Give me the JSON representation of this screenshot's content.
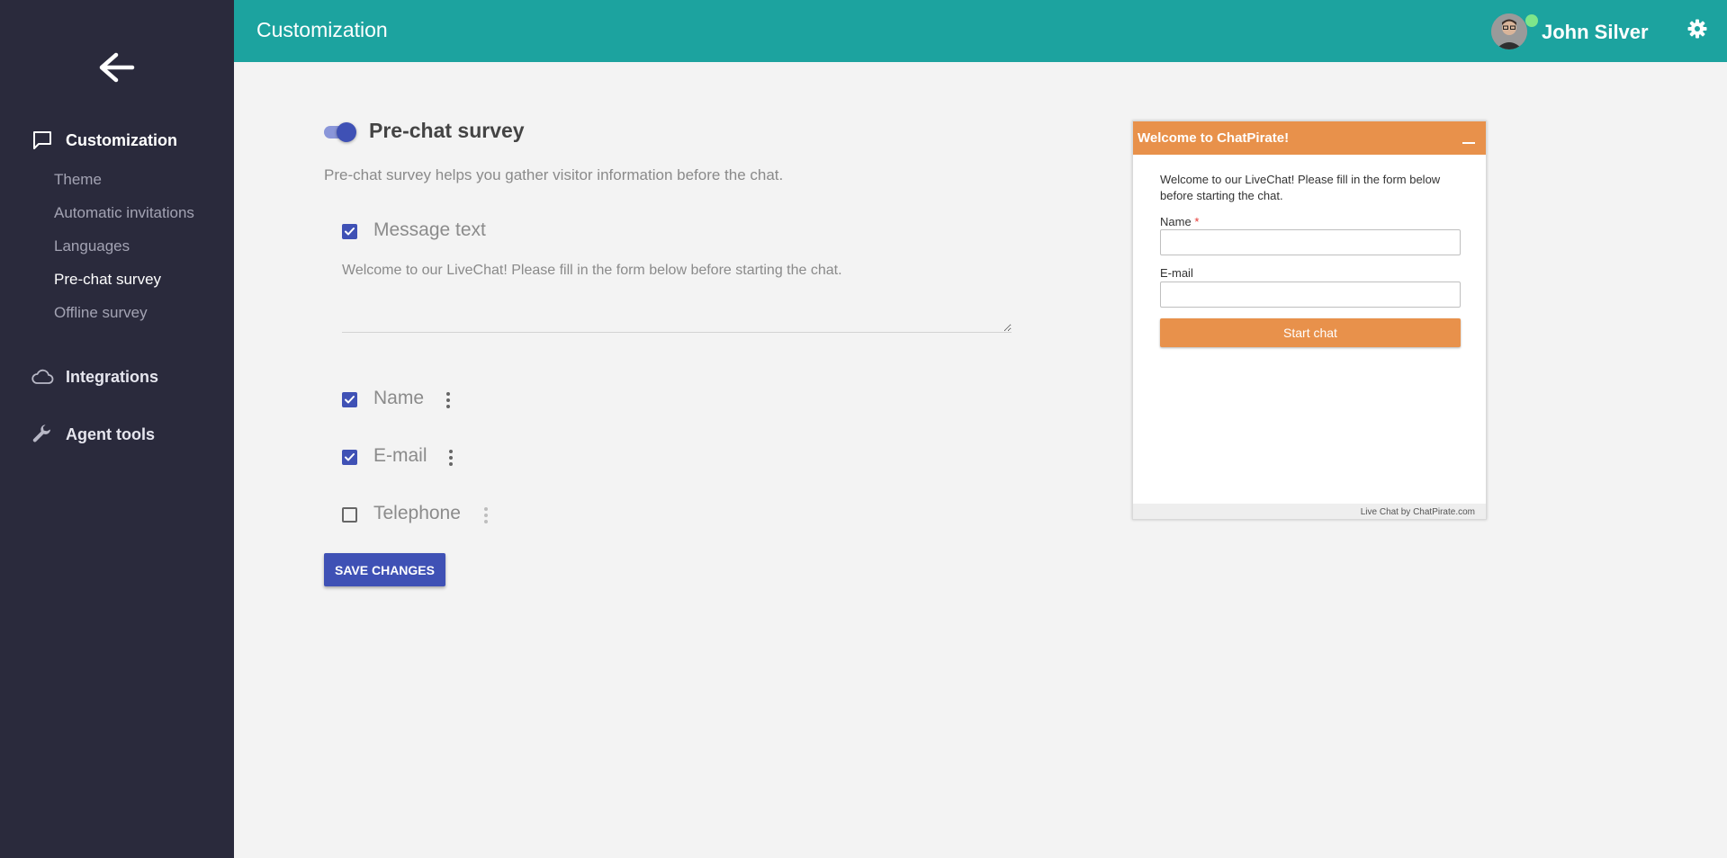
{
  "header": {
    "title": "Customization",
    "user_name": "John Silver"
  },
  "sidebar": {
    "sections": [
      {
        "label": "Customization",
        "icon": "chat-bubble-icon"
      },
      {
        "label": "Integrations",
        "icon": "cloud-icon"
      },
      {
        "label": "Agent tools",
        "icon": "wrench-icon"
      }
    ],
    "sub_items": [
      {
        "label": "Theme",
        "active": false
      },
      {
        "label": "Automatic invitations",
        "active": false
      },
      {
        "label": "Languages",
        "active": false
      },
      {
        "label": "Pre-chat survey",
        "active": true
      },
      {
        "label": "Offline survey",
        "active": false
      }
    ]
  },
  "main": {
    "toggle_on": true,
    "title": "Pre-chat survey",
    "description": "Pre-chat survey helps you gather visitor information before the chat.",
    "message_text": {
      "label": "Message text",
      "checked": true,
      "value": "Welcome to our LiveChat! Please fill in the form below before starting the chat."
    },
    "fields": [
      {
        "label": "Name",
        "checked": true
      },
      {
        "label": "E-mail",
        "checked": true
      },
      {
        "label": "Telephone",
        "checked": false
      }
    ],
    "save_label": "SAVE CHANGES"
  },
  "widget": {
    "title": "Welcome to ChatPirate!",
    "intro": "Welcome to our LiveChat! Please fill in the form below before starting the chat.",
    "name_label": "Name",
    "required_mark": "*",
    "email_label": "E-mail",
    "start_label": "Start chat",
    "footer": "Live Chat by ChatPirate.com"
  },
  "colors": {
    "sidebar": "#2a2a3c",
    "header": "#1ca39f",
    "primary": "#3f51b5",
    "widget_accent": "#e8914b",
    "online": "#7ee68a"
  }
}
